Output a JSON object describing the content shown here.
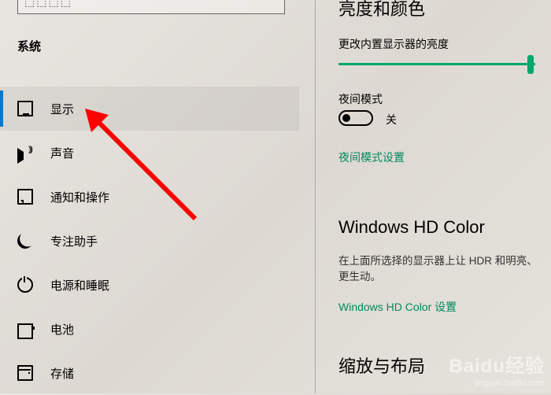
{
  "search": {
    "hint": "⬚⬚⬚⬚"
  },
  "category": "系统",
  "nav": [
    {
      "label": "显示",
      "selected": true,
      "icon": "display-icon"
    },
    {
      "label": "声音",
      "selected": false,
      "icon": "sound-icon"
    },
    {
      "label": "通知和操作",
      "selected": false,
      "icon": "notifications-icon"
    },
    {
      "label": "专注助手",
      "selected": false,
      "icon": "focus-assist-icon"
    },
    {
      "label": "电源和睡眠",
      "selected": false,
      "icon": "power-sleep-icon"
    },
    {
      "label": "电池",
      "selected": false,
      "icon": "battery-icon"
    },
    {
      "label": "存储",
      "selected": false,
      "icon": "storage-icon"
    }
  ],
  "content": {
    "section1_title": "亮度和颜色",
    "brightness_label": "更改内置显示器的亮度",
    "brightness_value": 100,
    "night_label": "夜间模式",
    "night_toggle_state": "关",
    "night_settings_link": "夜间模式设置",
    "section2_title": "Windows HD Color",
    "hdcolor_desc": "在上面所选择的显示器上让 HDR 和明亮、更生动。",
    "hdcolor_link": "Windows HD Color 设置",
    "section3_title": "缩放与布局"
  },
  "watermark": {
    "brand": "Baidu经验",
    "url": "jingyan.baidu.com"
  },
  "accent": "#00a86b"
}
